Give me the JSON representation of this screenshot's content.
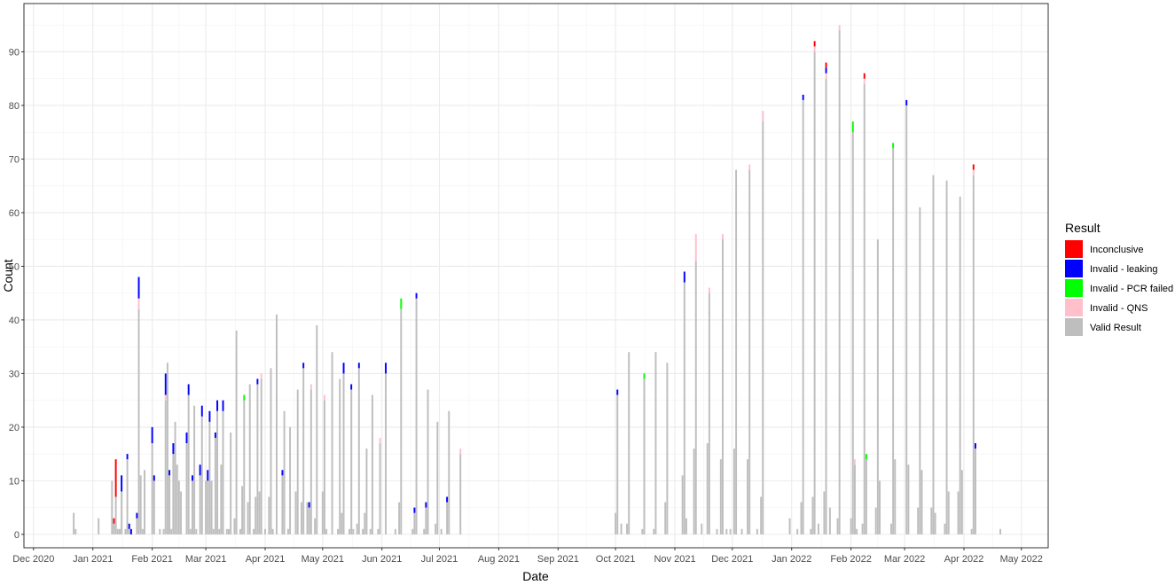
{
  "chart_data": {
    "type": "bar",
    "stacked": true,
    "xlabel": "Date",
    "ylabel": "Count",
    "ylim": [
      -2.5,
      99
    ],
    "y_ticks": [
      0,
      10,
      20,
      30,
      40,
      50,
      60,
      70,
      80,
      90
    ],
    "xlim": [
      "2020-11-26",
      "2022-05-15"
    ],
    "x_ticks": [
      {
        "date": "2020-12-01",
        "label": "Dec 2020"
      },
      {
        "date": "2021-01-01",
        "label": "Jan 2021"
      },
      {
        "date": "2021-02-01",
        "label": "Feb 2021"
      },
      {
        "date": "2021-03-01",
        "label": "Mar 2021"
      },
      {
        "date": "2021-04-01",
        "label": "Apr 2021"
      },
      {
        "date": "2021-05-01",
        "label": "May 2021"
      },
      {
        "date": "2021-06-01",
        "label": "Jun 2021"
      },
      {
        "date": "2021-07-01",
        "label": "Jul 2021"
      },
      {
        "date": "2021-08-01",
        "label": "Aug 2021"
      },
      {
        "date": "2021-09-01",
        "label": "Sep 2021"
      },
      {
        "date": "2021-10-01",
        "label": "Oct 2021"
      },
      {
        "date": "2021-11-01",
        "label": "Nov 2021"
      },
      {
        "date": "2021-12-01",
        "label": "Dec 2021"
      },
      {
        "date": "2022-01-01",
        "label": "Jan 2022"
      },
      {
        "date": "2022-02-01",
        "label": "Feb 2022"
      },
      {
        "date": "2022-03-01",
        "label": "Mar 2022"
      },
      {
        "date": "2022-04-01",
        "label": "Apr 2022"
      },
      {
        "date": "2022-05-01",
        "label": "May 2022"
      }
    ],
    "grid": true,
    "legend": {
      "title": "Result",
      "position": "right",
      "entries": [
        {
          "label": "Inconclusive",
          "color": "#ff0000"
        },
        {
          "label": "Invalid - leaking",
          "color": "#0000ff"
        },
        {
          "label": "Invalid - PCR failed",
          "color": "#00ff00"
        },
        {
          "label": "Invalid - QNS",
          "color": "#ffc0cb"
        },
        {
          "label": "Valid Result",
          "color": "#bebebe"
        }
      ]
    },
    "stack_order": [
      "Valid Result",
      "Invalid - QNS",
      "Invalid - PCR failed",
      "Invalid - leaking",
      "Inconclusive"
    ],
    "series_keys": {
      "Valid Result": "v",
      "Invalid - QNS": "q",
      "Invalid - PCR failed": "p",
      "Invalid - leaking": "l",
      "Inconclusive": "i"
    },
    "data": [
      {
        "date": "2020-12-22",
        "v": 4
      },
      {
        "date": "2020-12-23",
        "v": 1
      },
      {
        "date": "2021-01-04",
        "v": 3
      },
      {
        "date": "2021-01-11",
        "v": 10
      },
      {
        "date": "2021-01-12",
        "v": 2,
        "i": 1
      },
      {
        "date": "2021-01-13",
        "v": 7,
        "i": 7
      },
      {
        "date": "2021-01-14",
        "v": 1
      },
      {
        "date": "2021-01-15",
        "v": 1
      },
      {
        "date": "2021-01-16",
        "v": 8,
        "l": 3
      },
      {
        "date": "2021-01-18",
        "v": 1
      },
      {
        "date": "2021-01-19",
        "v": 14,
        "l": 1
      },
      {
        "date": "2021-01-20",
        "v": 1,
        "l": 1
      },
      {
        "date": "2021-01-21",
        "v": 0,
        "l": 1
      },
      {
        "date": "2021-01-24",
        "v": 3,
        "l": 1
      },
      {
        "date": "2021-01-25",
        "v": 42,
        "q": 2,
        "l": 4
      },
      {
        "date": "2021-01-26",
        "v": 11
      },
      {
        "date": "2021-01-27",
        "v": 1
      },
      {
        "date": "2021-01-28",
        "v": 12
      },
      {
        "date": "2021-02-01",
        "v": 17,
        "l": 3
      },
      {
        "date": "2021-02-02",
        "v": 10,
        "l": 1
      },
      {
        "date": "2021-02-05",
        "v": 1
      },
      {
        "date": "2021-02-07",
        "v": 1
      },
      {
        "date": "2021-02-08",
        "v": 25,
        "q": 1,
        "l": 4
      },
      {
        "date": "2021-02-09",
        "v": 32
      },
      {
        "date": "2021-02-10",
        "v": 11,
        "l": 1
      },
      {
        "date": "2021-02-11",
        "v": 1
      },
      {
        "date": "2021-02-12",
        "v": 15,
        "l": 2
      },
      {
        "date": "2021-02-13",
        "v": 21
      },
      {
        "date": "2021-02-14",
        "v": 13
      },
      {
        "date": "2021-02-15",
        "v": 10
      },
      {
        "date": "2021-02-16",
        "v": 8
      },
      {
        "date": "2021-02-19",
        "v": 17,
        "l": 2
      },
      {
        "date": "2021-02-20",
        "v": 26,
        "l": 2
      },
      {
        "date": "2021-02-21",
        "v": 1
      },
      {
        "date": "2021-02-22",
        "v": 10,
        "l": 1
      },
      {
        "date": "2021-02-23",
        "v": 24
      },
      {
        "date": "2021-02-24",
        "v": 1
      },
      {
        "date": "2021-02-26",
        "v": 11,
        "l": 2
      },
      {
        "date": "2021-02-27",
        "v": 22,
        "l": 2
      },
      {
        "date": "2021-03-01",
        "v": 10
      },
      {
        "date": "2021-03-02",
        "v": 10,
        "l": 2
      },
      {
        "date": "2021-03-03",
        "v": 21,
        "l": 2
      },
      {
        "date": "2021-03-04",
        "v": 10
      },
      {
        "date": "2021-03-05",
        "v": 1
      },
      {
        "date": "2021-03-06",
        "v": 18,
        "l": 1
      },
      {
        "date": "2021-03-07",
        "v": 23,
        "l": 2
      },
      {
        "date": "2021-03-08",
        "v": 1
      },
      {
        "date": "2021-03-09",
        "v": 13
      },
      {
        "date": "2021-03-10",
        "v": 23,
        "l": 2
      },
      {
        "date": "2021-03-12",
        "v": 1
      },
      {
        "date": "2021-03-13",
        "v": 1
      },
      {
        "date": "2021-03-14",
        "v": 19
      },
      {
        "date": "2021-03-16",
        "v": 3
      },
      {
        "date": "2021-03-17",
        "v": 38
      },
      {
        "date": "2021-03-19",
        "v": 1
      },
      {
        "date": "2021-03-20",
        "v": 9
      },
      {
        "date": "2021-03-21",
        "v": 25,
        "p": 1
      },
      {
        "date": "2021-03-23",
        "v": 6
      },
      {
        "date": "2021-03-24",
        "v": 28
      },
      {
        "date": "2021-03-26",
        "v": 1
      },
      {
        "date": "2021-03-27",
        "v": 7
      },
      {
        "date": "2021-03-28",
        "v": 28,
        "l": 1
      },
      {
        "date": "2021-03-29",
        "v": 8
      },
      {
        "date": "2021-03-30",
        "v": 29,
        "q": 1
      },
      {
        "date": "2021-04-01",
        "v": 1
      },
      {
        "date": "2021-04-03",
        "v": 7
      },
      {
        "date": "2021-04-04",
        "v": 31
      },
      {
        "date": "2021-04-05",
        "v": 1
      },
      {
        "date": "2021-04-07",
        "v": 41
      },
      {
        "date": "2021-04-10",
        "v": 11,
        "l": 1
      },
      {
        "date": "2021-04-11",
        "v": 23
      },
      {
        "date": "2021-04-13",
        "v": 1
      },
      {
        "date": "2021-04-14",
        "v": 20
      },
      {
        "date": "2021-04-17",
        "v": 8
      },
      {
        "date": "2021-04-18",
        "v": 27
      },
      {
        "date": "2021-04-20",
        "v": 6
      },
      {
        "date": "2021-04-21",
        "v": 31,
        "l": 1
      },
      {
        "date": "2021-04-23",
        "v": 6
      },
      {
        "date": "2021-04-24",
        "v": 5,
        "l": 1
      },
      {
        "date": "2021-04-25",
        "v": 27,
        "q": 1
      },
      {
        "date": "2021-04-27",
        "v": 3
      },
      {
        "date": "2021-04-28",
        "v": 39
      },
      {
        "date": "2021-05-01",
        "v": 8
      },
      {
        "date": "2021-05-02",
        "v": 25,
        "q": 1
      },
      {
        "date": "2021-05-03",
        "v": 1
      },
      {
        "date": "2021-05-06",
        "v": 34
      },
      {
        "date": "2021-05-09",
        "v": 1
      },
      {
        "date": "2021-05-10",
        "v": 29
      },
      {
        "date": "2021-05-11",
        "v": 4
      },
      {
        "date": "2021-05-12",
        "v": 30,
        "l": 2
      },
      {
        "date": "2021-05-15",
        "v": 1
      },
      {
        "date": "2021-05-16",
        "v": 27,
        "l": 1
      },
      {
        "date": "2021-05-17",
        "v": 1
      },
      {
        "date": "2021-05-19",
        "v": 2
      },
      {
        "date": "2021-05-20",
        "v": 31,
        "l": 1
      },
      {
        "date": "2021-05-22",
        "v": 1
      },
      {
        "date": "2021-05-23",
        "v": 4
      },
      {
        "date": "2021-05-24",
        "v": 16
      },
      {
        "date": "2021-05-26",
        "v": 1
      },
      {
        "date": "2021-05-27",
        "v": 26
      },
      {
        "date": "2021-05-30",
        "v": 1
      },
      {
        "date": "2021-05-31",
        "v": 17,
        "q": 1
      },
      {
        "date": "2021-06-03",
        "v": 30,
        "l": 2
      },
      {
        "date": "2021-06-08",
        "v": 1
      },
      {
        "date": "2021-06-10",
        "v": 6
      },
      {
        "date": "2021-06-11",
        "v": 42,
        "p": 2
      },
      {
        "date": "2021-06-17",
        "v": 1
      },
      {
        "date": "2021-06-18",
        "v": 4,
        "l": 1
      },
      {
        "date": "2021-06-19",
        "v": 44,
        "l": 1
      },
      {
        "date": "2021-06-23",
        "v": 1
      },
      {
        "date": "2021-06-24",
        "v": 5,
        "l": 1
      },
      {
        "date": "2021-06-25",
        "v": 27
      },
      {
        "date": "2021-06-29",
        "v": 2
      },
      {
        "date": "2021-06-30",
        "v": 21
      },
      {
        "date": "2021-07-02",
        "v": 1
      },
      {
        "date": "2021-07-05",
        "v": 6,
        "l": 1
      },
      {
        "date": "2021-07-06",
        "v": 23
      },
      {
        "date": "2021-07-12",
        "v": 15,
        "q": 1
      },
      {
        "date": "2021-10-01",
        "v": 4
      },
      {
        "date": "2021-10-02",
        "v": 26,
        "l": 1
      },
      {
        "date": "2021-10-04",
        "v": 2
      },
      {
        "date": "2021-10-07",
        "v": 2
      },
      {
        "date": "2021-10-08",
        "v": 34
      },
      {
        "date": "2021-10-15",
        "v": 1
      },
      {
        "date": "2021-10-16",
        "v": 29,
        "p": 1
      },
      {
        "date": "2021-10-21",
        "v": 1
      },
      {
        "date": "2021-10-22",
        "v": 34
      },
      {
        "date": "2021-10-27",
        "v": 6
      },
      {
        "date": "2021-10-28",
        "v": 32
      },
      {
        "date": "2021-11-05",
        "v": 11
      },
      {
        "date": "2021-11-06",
        "v": 47,
        "l": 2
      },
      {
        "date": "2021-11-07",
        "v": 3
      },
      {
        "date": "2021-11-11",
        "v": 16
      },
      {
        "date": "2021-11-12",
        "v": 51,
        "q": 5
      },
      {
        "date": "2021-11-15",
        "v": 2
      },
      {
        "date": "2021-11-18",
        "v": 17
      },
      {
        "date": "2021-11-19",
        "v": 45,
        "q": 1
      },
      {
        "date": "2021-11-23",
        "v": 1
      },
      {
        "date": "2021-11-25",
        "v": 14
      },
      {
        "date": "2021-11-26",
        "v": 55,
        "q": 1
      },
      {
        "date": "2021-11-28",
        "v": 1
      },
      {
        "date": "2021-11-30",
        "v": 1
      },
      {
        "date": "2021-12-02",
        "v": 16
      },
      {
        "date": "2021-12-03",
        "v": 68
      },
      {
        "date": "2021-12-06",
        "v": 1
      },
      {
        "date": "2021-12-09",
        "v": 14
      },
      {
        "date": "2021-12-10",
        "v": 68,
        "q": 1
      },
      {
        "date": "2021-12-14",
        "v": 1
      },
      {
        "date": "2021-12-16",
        "v": 7
      },
      {
        "date": "2021-12-17",
        "v": 77,
        "q": 2
      },
      {
        "date": "2021-12-31",
        "v": 3
      },
      {
        "date": "2022-01-04",
        "v": 1
      },
      {
        "date": "2022-01-06",
        "v": 6
      },
      {
        "date": "2022-01-07",
        "v": 81,
        "l": 1
      },
      {
        "date": "2022-01-11",
        "v": 1
      },
      {
        "date": "2022-01-12",
        "v": 7
      },
      {
        "date": "2022-01-13",
        "v": 90,
        "q": 1,
        "i": 1
      },
      {
        "date": "2022-01-15",
        "v": 2
      },
      {
        "date": "2022-01-18",
        "v": 8
      },
      {
        "date": "2022-01-19",
        "v": 85,
        "l": 1,
        "q": 1,
        "i": 1
      },
      {
        "date": "2022-01-21",
        "v": 5
      },
      {
        "date": "2022-01-25",
        "v": 3
      },
      {
        "date": "2022-01-26",
        "v": 94,
        "q": 1
      },
      {
        "date": "2022-02-01",
        "v": 3
      },
      {
        "date": "2022-02-02",
        "v": 75,
        "p": 2
      },
      {
        "date": "2022-02-03",
        "v": 13,
        "q": 1
      },
      {
        "date": "2022-02-04",
        "v": 1
      },
      {
        "date": "2022-02-07",
        "v": 2
      },
      {
        "date": "2022-02-08",
        "v": 84,
        "q": 1,
        "i": 1
      },
      {
        "date": "2022-02-09",
        "v": 14,
        "p": 1
      },
      {
        "date": "2022-02-14",
        "v": 5
      },
      {
        "date": "2022-02-15",
        "v": 55
      },
      {
        "date": "2022-02-16",
        "v": 10
      },
      {
        "date": "2022-02-22",
        "v": 2
      },
      {
        "date": "2022-02-23",
        "v": 72,
        "p": 1
      },
      {
        "date": "2022-02-24",
        "v": 14
      },
      {
        "date": "2022-03-02",
        "v": 80,
        "l": 1
      },
      {
        "date": "2022-03-03",
        "v": 13
      },
      {
        "date": "2022-03-08",
        "v": 5
      },
      {
        "date": "2022-03-09",
        "v": 61
      },
      {
        "date": "2022-03-10",
        "v": 12
      },
      {
        "date": "2022-03-15",
        "v": 5
      },
      {
        "date": "2022-03-16",
        "v": 67
      },
      {
        "date": "2022-03-17",
        "v": 4
      },
      {
        "date": "2022-03-22",
        "v": 2
      },
      {
        "date": "2022-03-23",
        "v": 66
      },
      {
        "date": "2022-03-24",
        "v": 8
      },
      {
        "date": "2022-03-29",
        "v": 8
      },
      {
        "date": "2022-03-30",
        "v": 63
      },
      {
        "date": "2022-03-31",
        "v": 12
      },
      {
        "date": "2022-04-05",
        "v": 1
      },
      {
        "date": "2022-04-06",
        "v": 67,
        "q": 1,
        "i": 1
      },
      {
        "date": "2022-04-07",
        "v": 16,
        "l": 1
      },
      {
        "date": "2022-04-20",
        "v": 1
      }
    ]
  }
}
